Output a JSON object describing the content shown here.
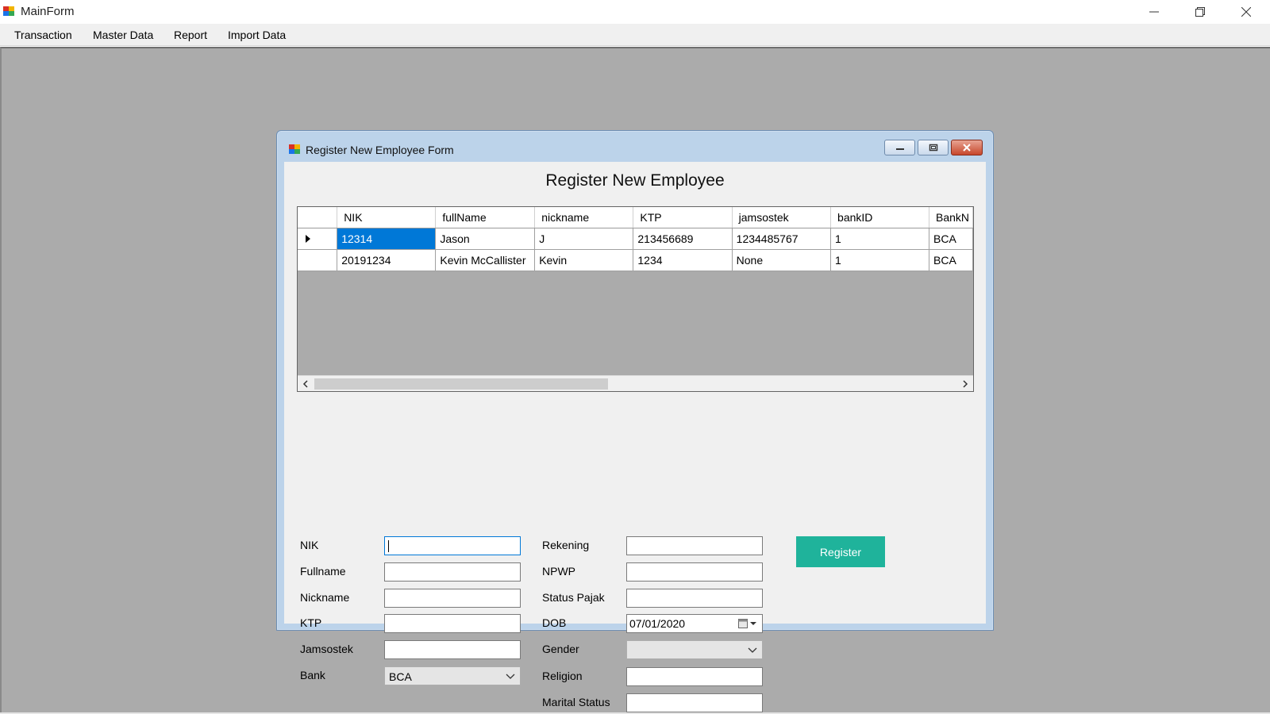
{
  "main_window": {
    "title": "MainForm"
  },
  "menubar": {
    "items": [
      "Transaction",
      "Master Data",
      "Report",
      "Import Data"
    ]
  },
  "child_window": {
    "title": "Register New Employee Form"
  },
  "form": {
    "heading": "Register New Employee",
    "register_label": "Register",
    "left_fields": [
      {
        "label": "NIK",
        "value": ""
      },
      {
        "label": "Fullname",
        "value": ""
      },
      {
        "label": "Nickname",
        "value": ""
      },
      {
        "label": "KTP",
        "value": ""
      },
      {
        "label": "Jamsostek",
        "value": ""
      },
      {
        "label": "Bank",
        "value": "BCA"
      }
    ],
    "right_fields": [
      {
        "label": "Rekening",
        "value": ""
      },
      {
        "label": "NPWP",
        "value": ""
      },
      {
        "label": "Status Pajak",
        "value": ""
      },
      {
        "label": "DOB",
        "value": "07/01/2020"
      },
      {
        "label": "Gender",
        "value": ""
      },
      {
        "label": "Religion",
        "value": ""
      },
      {
        "label": "Marital Status",
        "value": ""
      }
    ]
  },
  "grid": {
    "columns": [
      "NIK",
      "fullName",
      "nickname",
      "KTP",
      "jamsostek",
      "bankID",
      "BankN"
    ],
    "rows": [
      [
        "12314",
        "Jason",
        "J",
        "213456689",
        "1234485767",
        "1",
        "BCA"
      ],
      [
        "20191234",
        "Kevin McCallister",
        "Kevin",
        "1234",
        "None",
        "1",
        "BCA"
      ]
    ]
  },
  "colors": {
    "accent": "#1fb39b",
    "selection": "#0078d7",
    "mdi_background": "#ababab"
  }
}
